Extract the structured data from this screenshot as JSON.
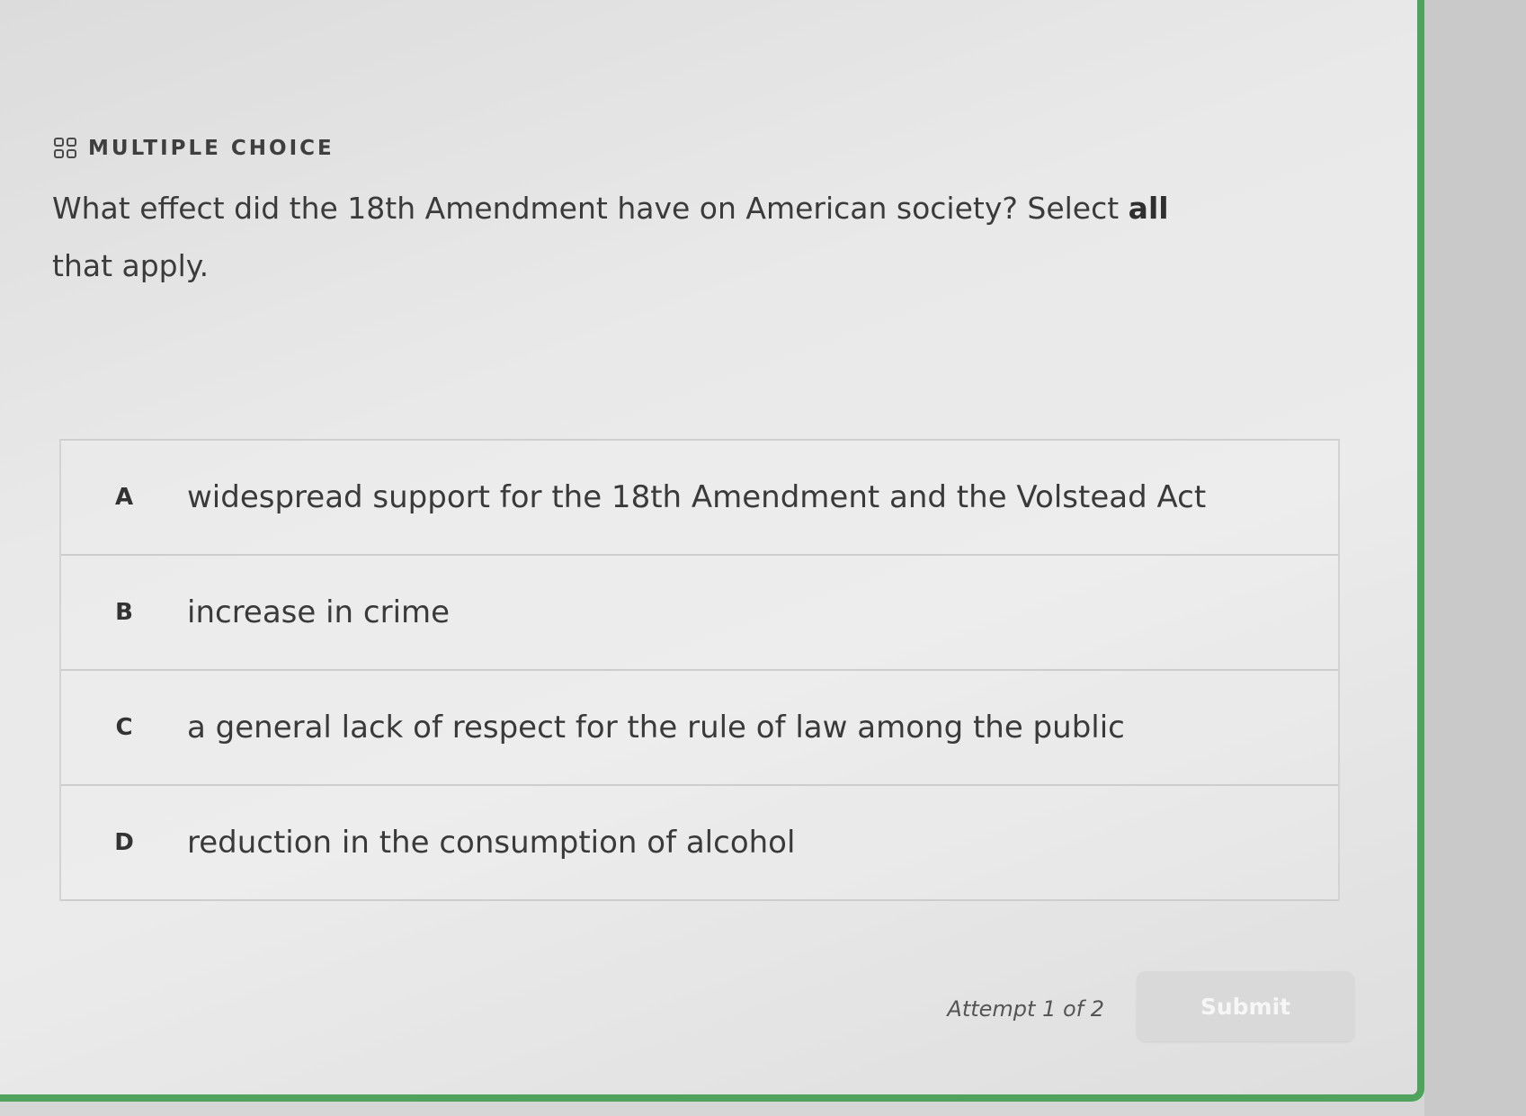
{
  "header": {
    "icon": "grid-icon",
    "label": "MULTIPLE CHOICE"
  },
  "question": {
    "before_bold": "What effect did the 18th Amendment have on American society? Select ",
    "bold": "all",
    "after_bold": " that apply."
  },
  "choices": [
    {
      "letter": "A",
      "text": "widespread support for the 18th Amendment and the Volstead Act"
    },
    {
      "letter": "B",
      "text": "increase in crime"
    },
    {
      "letter": "C",
      "text": "a general lack of respect for the rule of law among the public"
    },
    {
      "letter": "D",
      "text": "reduction in the consumption of alcohol"
    }
  ],
  "footer": {
    "attempt_text": "Attempt 1 of 2",
    "submit_label": "Submit"
  },
  "colors": {
    "accent_border": "#4fa35c",
    "submit_disabled_bg": "#d9d9d9"
  }
}
